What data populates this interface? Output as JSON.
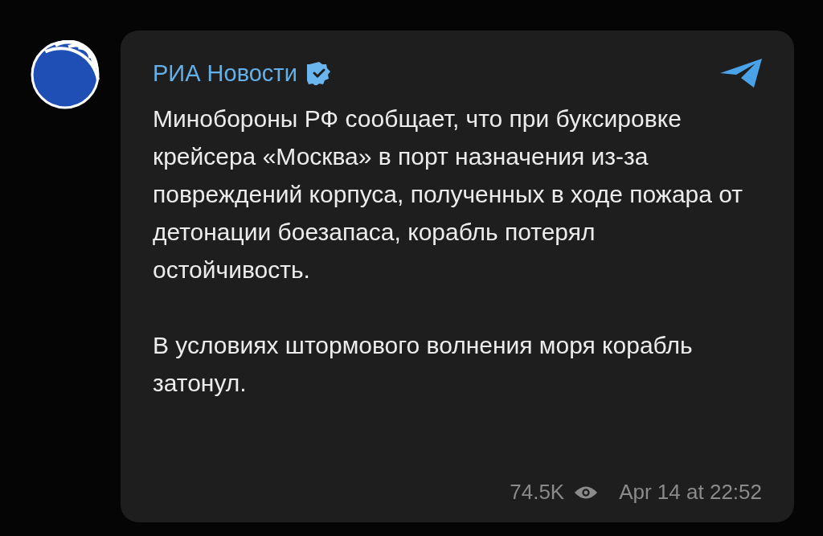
{
  "channel": {
    "name": "РИА Новости",
    "verified": true
  },
  "message": {
    "paragraphs": [
      "Минобороны РФ сообщает, что при буксировке крейсера «Москва» в порт назначения из-за повреждений корпуса, полученных в ходе пожара от детонации боезапаса, корабль потерял остойчивость.",
      "В условиях штормового волнения моря корабль затонул."
    ],
    "views": "74.5K",
    "time": "Apr 14 at 22:52"
  }
}
